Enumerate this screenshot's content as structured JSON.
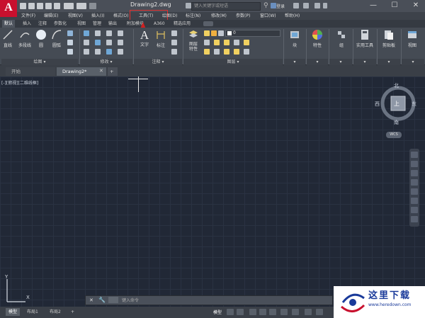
{
  "app": {
    "logo_letter": "A",
    "document_title": "Drawing2.dwg",
    "search_placeholder": "键入关键字或短语",
    "login_label": "登录",
    "window_controls": [
      "—",
      "☐",
      "✕"
    ]
  },
  "menubar": {
    "items": [
      "文件(F)",
      "编辑(E)",
      "视图(V)",
      "插入(I)",
      "格式(O)",
      "工具(T)",
      "绘图(D)",
      "标注(N)",
      "修改(M)",
      "参数(P)",
      "窗口(W)",
      "帮助(H)"
    ],
    "highlighted_index": 5,
    "highlight_color": "#e03030"
  },
  "ribbon_tabs": {
    "items": [
      "默认",
      "插入",
      "注释",
      "参数化",
      "视图",
      "管理",
      "输出",
      "附加模块",
      "A360",
      "精选应用"
    ],
    "active_index": 0
  },
  "ribbon": {
    "draw_panel": {
      "title": "绘图 ▾",
      "tools": [
        "直线",
        "多段线",
        "圆",
        "圆弧"
      ]
    },
    "modify_panel": {
      "title": "修改 ▾"
    },
    "annotation_panel": {
      "title": "注释 ▾",
      "tools": [
        "文字",
        "标注"
      ]
    },
    "layers_panel": {
      "title": "图层 ▾",
      "tool": "图层\n特性",
      "layer_value": "0"
    },
    "right_tools": [
      "块",
      "特性",
      "组",
      "实用工具",
      "剪贴板",
      "视图"
    ]
  },
  "file_tabs": {
    "items": [
      "开始",
      "Drawing2*"
    ],
    "active_index": 1,
    "add_label": "+"
  },
  "drawing": {
    "view_label": "[-][俯视][二维线框]"
  },
  "viewcube": {
    "north": "北",
    "south": "南",
    "east": "东",
    "west": "西",
    "top": "上",
    "wcs": "WCS"
  },
  "command_line": {
    "placeholder": "键入命令"
  },
  "layout_tabs": {
    "items": [
      "模型",
      "布局1",
      "布局2"
    ],
    "active_index": 0,
    "add_label": "+"
  },
  "status": {
    "model_label": "模型"
  },
  "ucs": {
    "x": "X",
    "y": "Y"
  },
  "watermark": {
    "title": "这里下载",
    "url": "www.heredown.com"
  }
}
